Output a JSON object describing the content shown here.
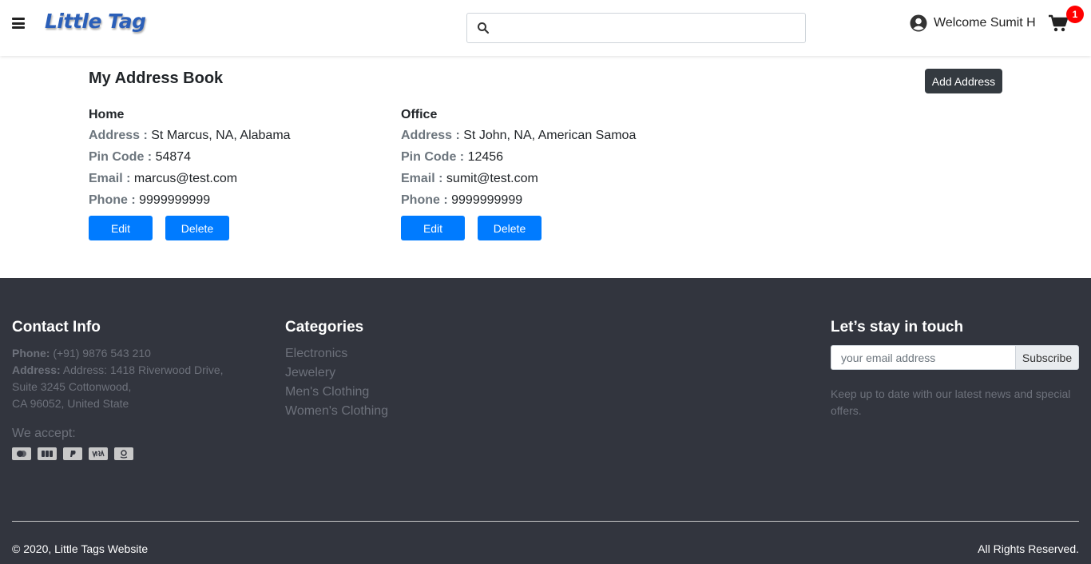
{
  "header": {
    "logo": "Little Tag",
    "search_placeholder": "",
    "welcome": "Welcome Sumit H",
    "cart_count": "1"
  },
  "main": {
    "title": "My Address Book",
    "add_button": "Add Address",
    "addresses": [
      {
        "name": "Home",
        "address_label": "Address :",
        "address": "St Marcus, NA, Alabama",
        "pin_label": "Pin Code :",
        "pin": "54874",
        "email_label": "Email :",
        "email": "marcus@test.com",
        "phone_label": "Phone :",
        "phone": "9999999999",
        "edit": "Edit",
        "delete": "Delete"
      },
      {
        "name": "Office",
        "address_label": "Address :",
        "address": "St John, NA, American Samoa",
        "pin_label": "Pin Code :",
        "pin": "12456",
        "email_label": "Email :",
        "email": "sumit@test.com",
        "phone_label": "Phone :",
        "phone": "9999999999",
        "edit": "Edit",
        "delete": "Delete"
      }
    ]
  },
  "footer": {
    "contact": {
      "title": "Contact Info",
      "phone_label": "Phone:",
      "phone": "(+91) 9876 543 210",
      "address_label": "Address:",
      "address_line1": "Address: 1418 Riverwood Drive,",
      "address_line2": "Suite 3245 Cottonwood,",
      "address_line3": "CA 96052, United State",
      "accept": "We accept:",
      "payments": [
        "mastercard-icon",
        "jcb-icon",
        "paypal-icon",
        "visa-icon",
        "amazon-icon"
      ]
    },
    "categories": {
      "title": "Categories",
      "items": [
        "Electronics",
        "Jewelery",
        "Men's Clothing",
        "Women's Clothing"
      ]
    },
    "newsletter": {
      "title": "Let’s stay in touch",
      "placeholder": "your email address",
      "button": "Subscribe",
      "text": "Keep up to date with our latest news and special offers."
    },
    "copyright": "© 2020, Little Tags Website",
    "rights": "All Rights Reserved."
  },
  "colors": {
    "primary": "#007bff",
    "dark": "#343a40",
    "footer_bg": "#32353e",
    "badge": "#ff0000"
  }
}
